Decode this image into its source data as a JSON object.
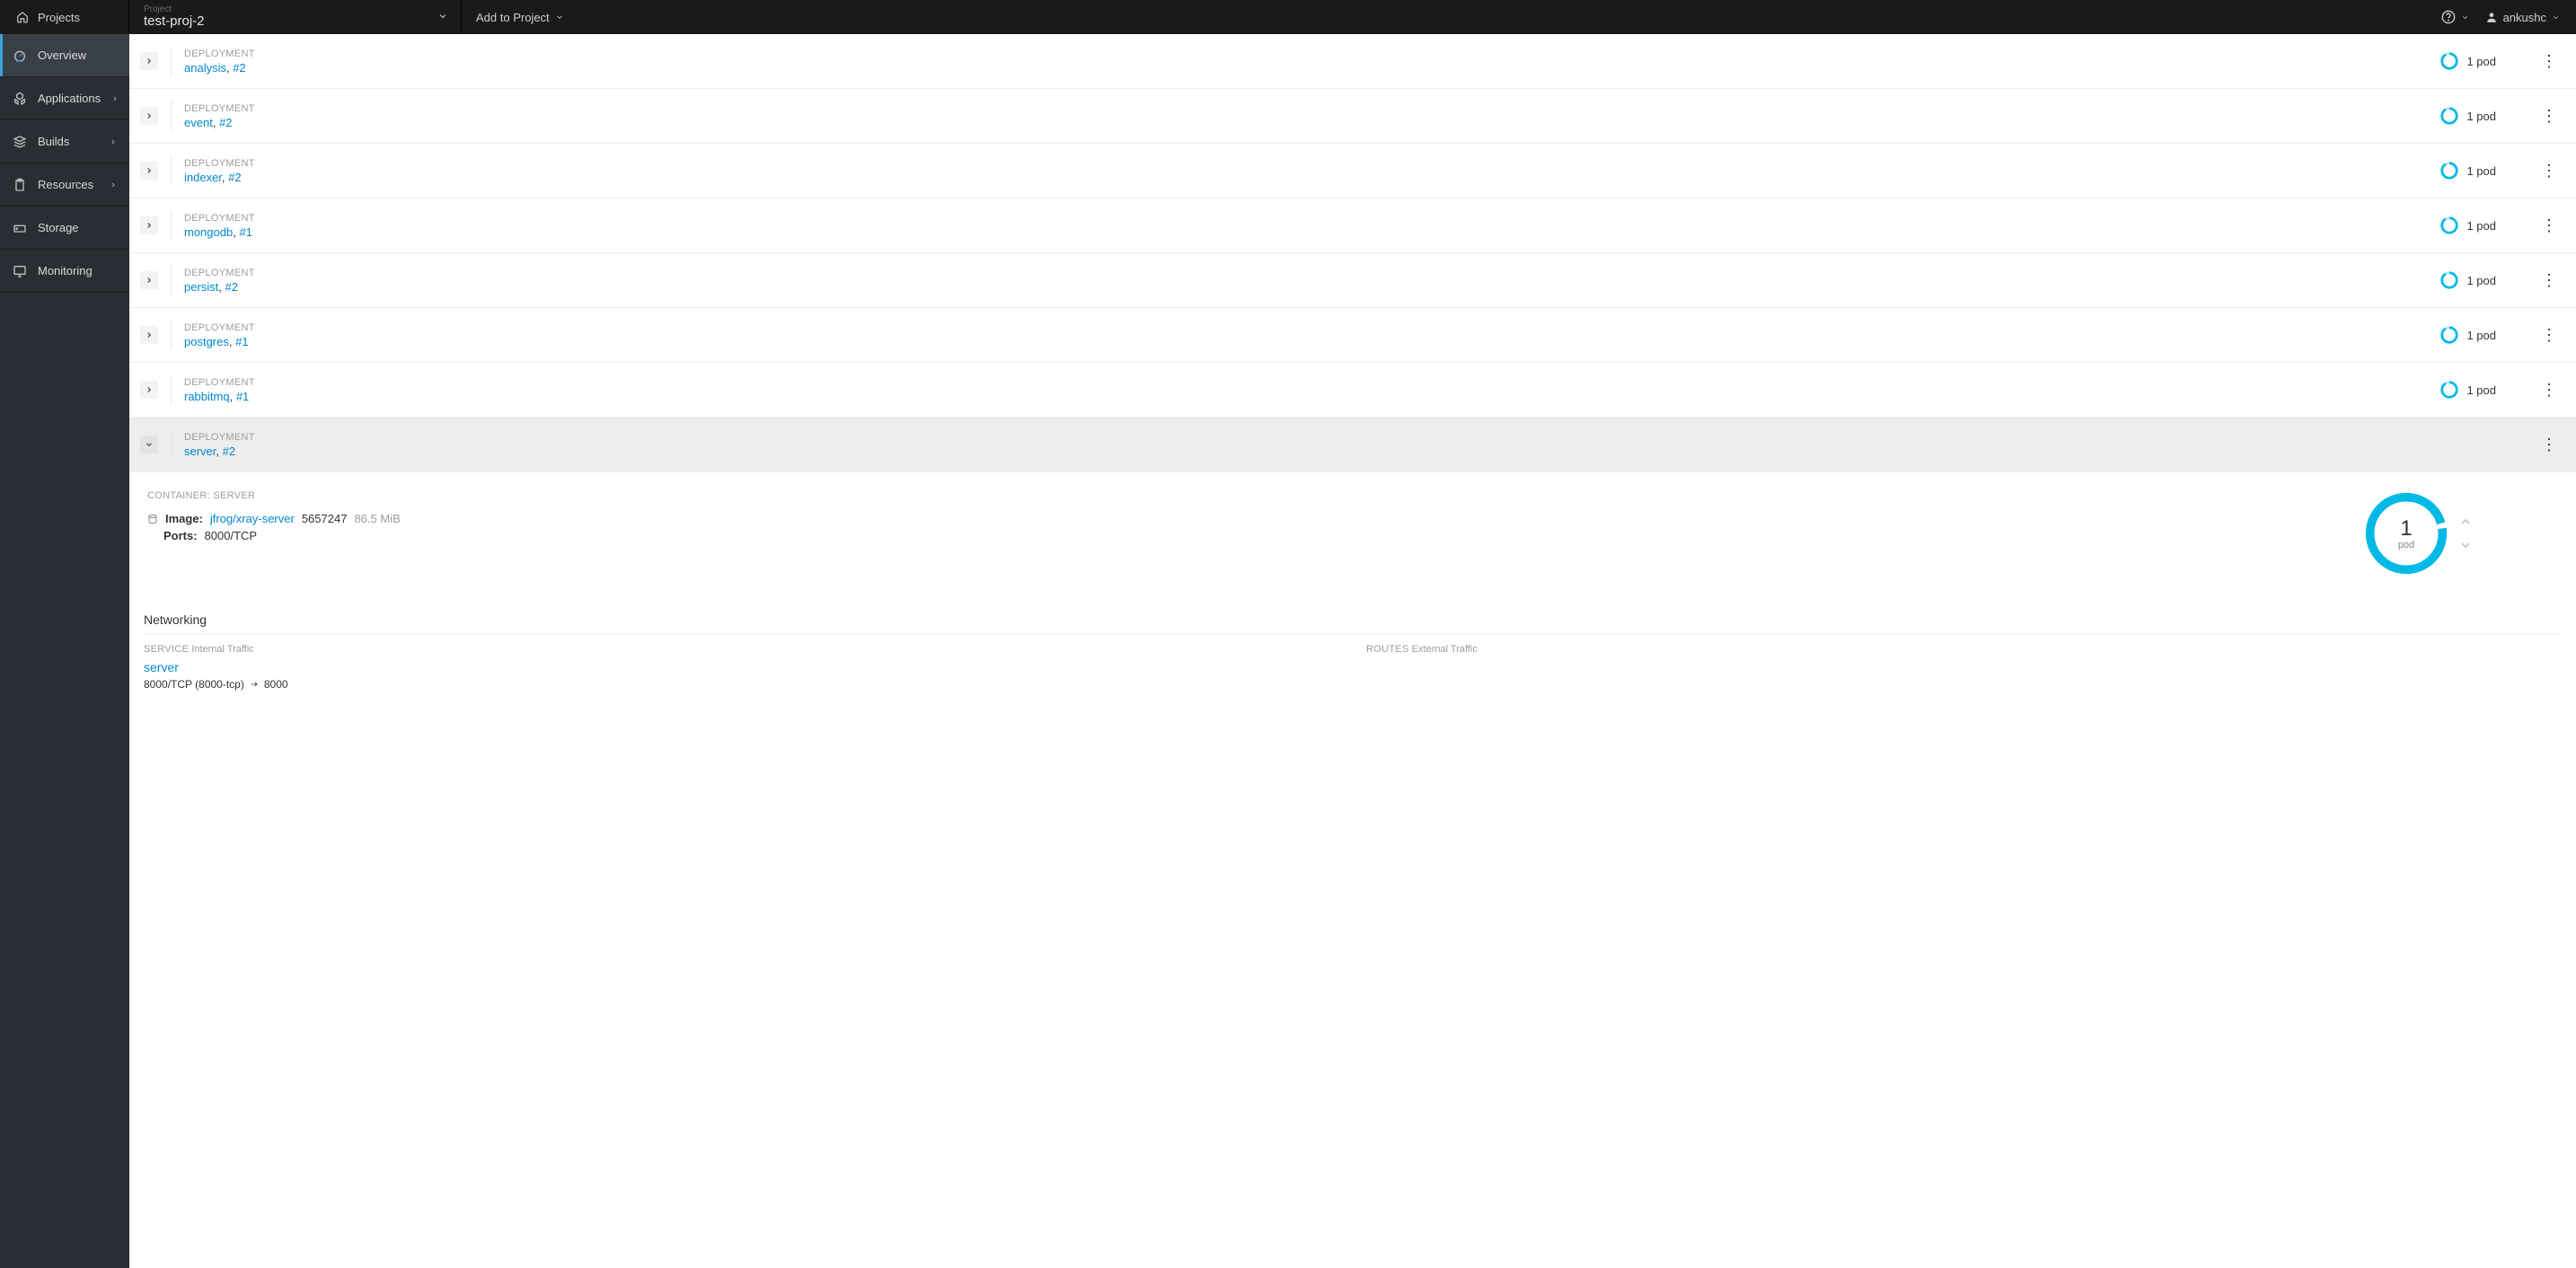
{
  "topbar": {
    "projects_label": "Projects",
    "project_field_label": "Project",
    "project_name": "test-proj-2",
    "add_to_project": "Add to Project",
    "username": "ankushc"
  },
  "sidebar": {
    "items": [
      {
        "label": "Overview",
        "icon": "dashboard-icon",
        "expandable": false,
        "active": true
      },
      {
        "label": "Applications",
        "icon": "cubes-icon",
        "expandable": true,
        "active": false
      },
      {
        "label": "Builds",
        "icon": "stack-icon",
        "expandable": true,
        "active": false
      },
      {
        "label": "Resources",
        "icon": "clipboard-icon",
        "expandable": true,
        "active": false
      },
      {
        "label": "Storage",
        "icon": "storage-icon",
        "expandable": false,
        "active": false
      },
      {
        "label": "Monitoring",
        "icon": "monitor-icon",
        "expandable": false,
        "active": false
      }
    ]
  },
  "deployments": [
    {
      "type": "DEPLOYMENT",
      "name": "analysis",
      "version": "#2",
      "pods": "1 pod",
      "expanded": false
    },
    {
      "type": "DEPLOYMENT",
      "name": "event",
      "version": "#2",
      "pods": "1 pod",
      "expanded": false
    },
    {
      "type": "DEPLOYMENT",
      "name": "indexer",
      "version": "#2",
      "pods": "1 pod",
      "expanded": false
    },
    {
      "type": "DEPLOYMENT",
      "name": "mongodb",
      "version": "#1",
      "pods": "1 pod",
      "expanded": false
    },
    {
      "type": "DEPLOYMENT",
      "name": "persist",
      "version": "#2",
      "pods": "1 pod",
      "expanded": false
    },
    {
      "type": "DEPLOYMENT",
      "name": "postgres",
      "version": "#1",
      "pods": "1 pod",
      "expanded": false
    },
    {
      "type": "DEPLOYMENT",
      "name": "rabbitmq",
      "version": "#1",
      "pods": "1 pod",
      "expanded": false
    },
    {
      "type": "DEPLOYMENT",
      "name": "server",
      "version": "#2",
      "pods": "1 pod",
      "expanded": true
    }
  ],
  "detail": {
    "container_label": "CONTAINER: SERVER",
    "image_label": "Image:",
    "image_name": "jfrog/xray-server",
    "image_hash": "5657247",
    "image_size": "86.5 MiB",
    "ports_label": "Ports:",
    "ports_value": "8000/TCP",
    "pod_count": "1",
    "pod_unit": "pod",
    "networking_heading": "Networking",
    "service_heading_1": "SERVICE",
    "service_heading_2": "Internal Traffic",
    "routes_heading_1": "ROUTES",
    "routes_heading_2": "External Traffic",
    "service_name": "server",
    "service_port_a": "8000/TCP (8000-tcp)",
    "service_port_b": "8000"
  }
}
